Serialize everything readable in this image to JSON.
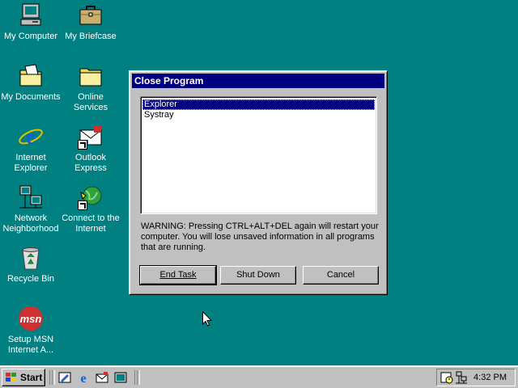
{
  "desktop": {
    "icons": [
      {
        "label": "My Computer",
        "name": "my-computer-icon"
      },
      {
        "label": "My Briefcase",
        "name": "briefcase-icon"
      },
      {
        "label": "My Documents",
        "name": "folder-documents-icon"
      },
      {
        "label": "Online\nServices",
        "name": "folder-icon"
      },
      {
        "label": "Internet\nExplorer",
        "name": "internet-explorer-icon"
      },
      {
        "label": "Outlook\nExpress",
        "name": "outlook-express-icon"
      },
      {
        "label": "Network\nNeighborhood",
        "name": "network-icon"
      },
      {
        "label": "Connect to the\nInternet",
        "name": "connect-internet-icon"
      },
      {
        "label": "Recycle Bin",
        "name": "recycle-bin-icon"
      },
      {
        "label": "Setup MSN\nInternet A...",
        "name": "msn-icon"
      }
    ],
    "background_color": "#008080"
  },
  "dialog": {
    "title": "Close Program",
    "programs": [
      "Explorer",
      "Systray"
    ],
    "selected": "Explorer",
    "warning": "WARNING: Pressing CTRL+ALT+DEL again will restart your computer. You will lose unsaved information in all programs that are running.",
    "buttons": {
      "end_task": "End Task",
      "shut_down": "Shut Down",
      "cancel": "Cancel"
    },
    "title_color": "#000080"
  },
  "taskbar": {
    "start_label": "Start",
    "quick_launch": [
      "show-desktop-icon",
      "internet-explorer-icon",
      "outlook-express-icon",
      "channels-icon"
    ],
    "tray_icons": [
      "scheduler-icon",
      "network-tray-icon"
    ],
    "clock": "4:32 PM"
  }
}
